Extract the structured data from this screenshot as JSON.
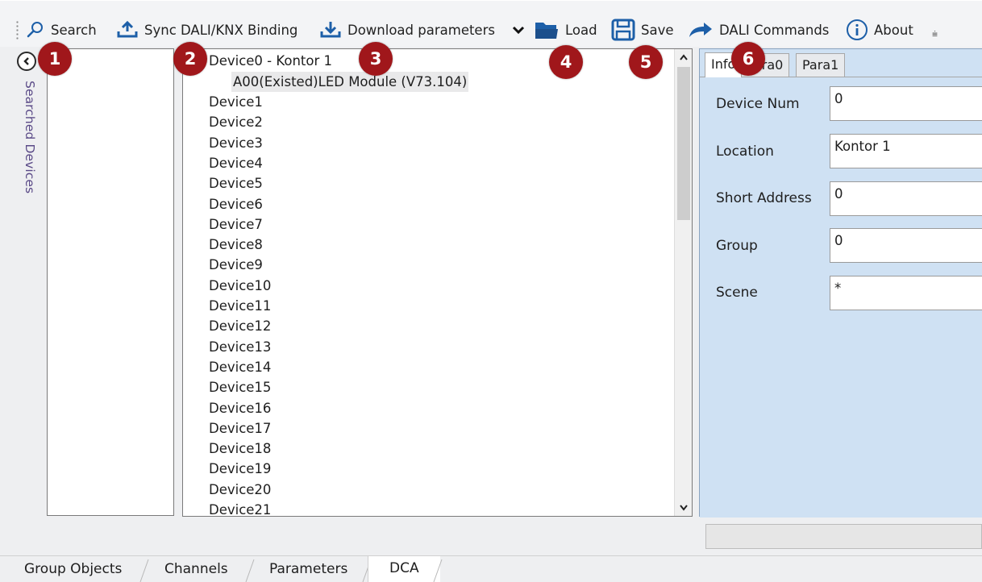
{
  "toolbar": {
    "search": "Search",
    "sync": "Sync DALI/KNX Binding",
    "download": "Download parameters",
    "load": "Load",
    "save": "Save",
    "dali_commands": "DALI Commands",
    "about": "About",
    "overflow": "⩧"
  },
  "badges": [
    "1",
    "2",
    "3",
    "4",
    "5",
    "6"
  ],
  "side_panel": {
    "collapse_glyph": "‹",
    "label": "Searched Devices"
  },
  "tree": {
    "root_expanded": "Device0 - Kontor 1",
    "child": "A00(Existed)LED Module (V73.104)",
    "devices": [
      "Device1",
      "Device2",
      "Device3",
      "Device4",
      "Device5",
      "Device6",
      "Device7",
      "Device8",
      "Device9",
      "Device10",
      "Device11",
      "Device12",
      "Device13",
      "Device14",
      "Device15",
      "Device16",
      "Device17",
      "Device18",
      "Device19",
      "Device20",
      "Device21"
    ]
  },
  "scrollbar": {
    "up": "▴",
    "down": "▾"
  },
  "detail": {
    "tabs": [
      "Info",
      "Para0",
      "Para1"
    ],
    "active_tab": "Info",
    "fields": [
      {
        "label": "Device Num",
        "value": "0"
      },
      {
        "label": "Location",
        "value": "Kontor 1"
      },
      {
        "label": "Short Address",
        "value": "0"
      },
      {
        "label": "Group",
        "value": "0"
      },
      {
        "label": "Scene",
        "value": "*"
      }
    ]
  },
  "bottom_tabs": [
    "Group Objects",
    "Channels",
    "Parameters",
    "DCA"
  ],
  "active_bottom_tab": "DCA",
  "colors": {
    "badge": "#a0171b",
    "detail_bg": "#cfe1f3",
    "side_label": "#5a4a87"
  }
}
